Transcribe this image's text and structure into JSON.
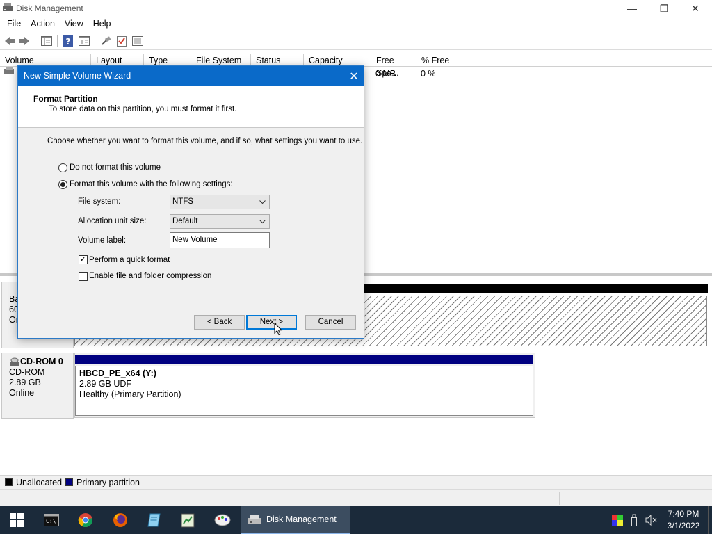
{
  "window": {
    "title": "Disk Management",
    "icon": "disk-management-icon"
  },
  "menubar": {
    "items": [
      "File",
      "Action",
      "View",
      "Help"
    ]
  },
  "toolbar": {
    "icons": [
      "back-arrow-icon",
      "forward-arrow-icon",
      "console-tree-icon",
      "help-icon",
      "properties-icon",
      "connect-icon",
      "checklist-icon",
      "settings-icon"
    ]
  },
  "volume_list": {
    "columns": [
      "Volume",
      "Layout",
      "Type",
      "File System",
      "Status",
      "Capacity",
      "Free Spa...",
      "% Free"
    ],
    "row1": {
      "free_space": "0 MB",
      "percent_free": "0 %"
    }
  },
  "disk0": {
    "line1": "Ba",
    "line2": "60.",
    "line3": "Or"
  },
  "cdrom": {
    "name": "CD-ROM 0",
    "type": "CD-ROM",
    "size": "2.89 GB",
    "status": "Online",
    "volume_name": "HBCD_PE_x64  (Y:)",
    "volume_size": "2.89 GB UDF",
    "volume_status": "Healthy (Primary Partition)"
  },
  "legend": {
    "unallocated": "Unallocated",
    "primary": "Primary partition"
  },
  "colors": {
    "unallocated": "#000000",
    "primary": "#000080",
    "accent": "#0a6ac9"
  },
  "dialog": {
    "title": "New Simple Volume Wizard",
    "header_title": "Format Partition",
    "header_subtitle": "To store data on this partition, you must format it first.",
    "instruction": "Choose whether you want to format this volume, and if so, what settings you want to use.",
    "option_no_format": "Do not format this volume",
    "option_format": "Format this volume with the following settings:",
    "selected_option": "format",
    "file_system_label": "File system:",
    "file_system_value": "NTFS",
    "allocation_label": "Allocation unit size:",
    "allocation_value": "Default",
    "volume_label_label": "Volume label:",
    "volume_label_value": "New Volume",
    "quick_format_label": "Perform a quick format",
    "quick_format_checked": true,
    "compression_label": "Enable file and folder compression",
    "compression_checked": false,
    "back_label": "< Back",
    "next_label": "Next >",
    "cancel_label": "Cancel"
  },
  "taskbar": {
    "active_app": "Disk Management",
    "time": "7:40 PM",
    "date": "3/1/2022"
  }
}
